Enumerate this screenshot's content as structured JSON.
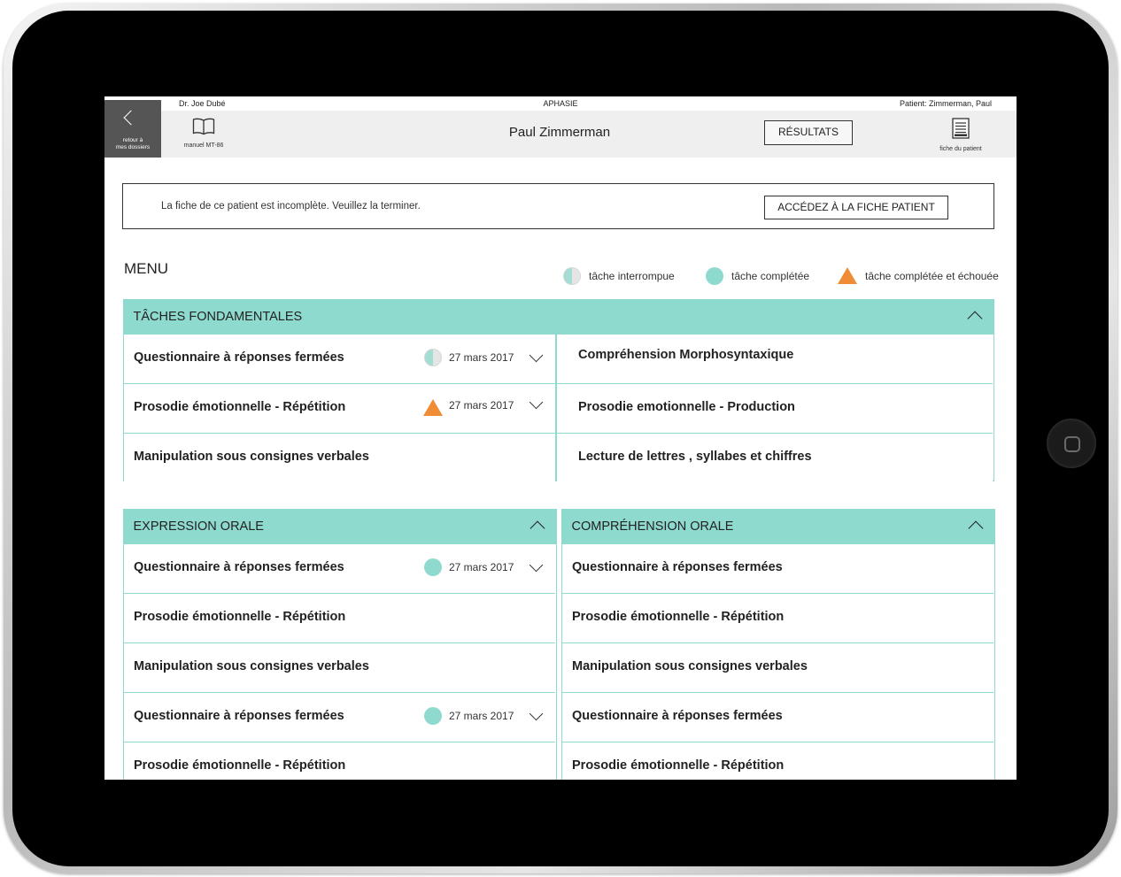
{
  "header": {
    "doctor": "Dr.  Joe Dubé",
    "program": "APHASIE",
    "patient_tag": "Patient:  Zimmerman, Paul",
    "back_label_1": "retour à",
    "back_label_2": "mes dossiers",
    "manual_label": "manuel MT-86",
    "patient_name": "Paul Zimmerman",
    "results_button": "RÉSULTATS",
    "fiche_label": "fiche du patient"
  },
  "alert": {
    "text": "La fiche de ce patient est incomplète. Veuillez la terminer.",
    "button": "ACCÉDEZ À LA FICHE PATIENT"
  },
  "menu": {
    "title": "MENU",
    "legend": {
      "interrupted": "tâche interrompue",
      "completed": "tâche complétée",
      "failed": "tâche complétée et échouée"
    }
  },
  "colors": {
    "teal": "#8fdace",
    "orange": "#ef8c35",
    "dark": "#555555"
  },
  "sections": {
    "fondamentales": {
      "title": "TÂCHES FONDAMENTALES",
      "left": [
        {
          "name": "Questionnaire à réponses fermées",
          "status": "interrupted",
          "date": "27 mars 2017"
        },
        {
          "name": "Prosodie émotionnelle - Répétition",
          "status": "failed",
          "date": "27 mars 2017"
        },
        {
          "name": "Manipulation sous consignes verbales"
        }
      ],
      "right": [
        {
          "name": "Compréhension Morphosyntaxique"
        },
        {
          "name": "Prosodie emotionnelle - Production"
        },
        {
          "name": "Lecture de lettres , syllabes et chiffres"
        }
      ]
    },
    "expression": {
      "title": "EXPRESSION ORALE",
      "rows": [
        {
          "name": "Questionnaire à réponses fermées",
          "status": "completed",
          "date": "27 mars 2017"
        },
        {
          "name": "Prosodie émotionnelle - Répétition"
        },
        {
          "name": "Manipulation sous consignes verbales"
        },
        {
          "name": "Questionnaire à réponses fermées",
          "status": "completed",
          "date": "27 mars 2017"
        },
        {
          "name": "Prosodie émotionnelle - Répétition"
        }
      ]
    },
    "comprehension": {
      "title": "COMPRÉHENSION ORALE",
      "rows": [
        {
          "name": "Questionnaire à réponses fermées"
        },
        {
          "name": "Prosodie émotionnelle - Répétition"
        },
        {
          "name": "Manipulation sous consignes verbales"
        },
        {
          "name": "Questionnaire à réponses fermées"
        },
        {
          "name": "Prosodie émotionnelle - Répétition"
        }
      ]
    }
  }
}
